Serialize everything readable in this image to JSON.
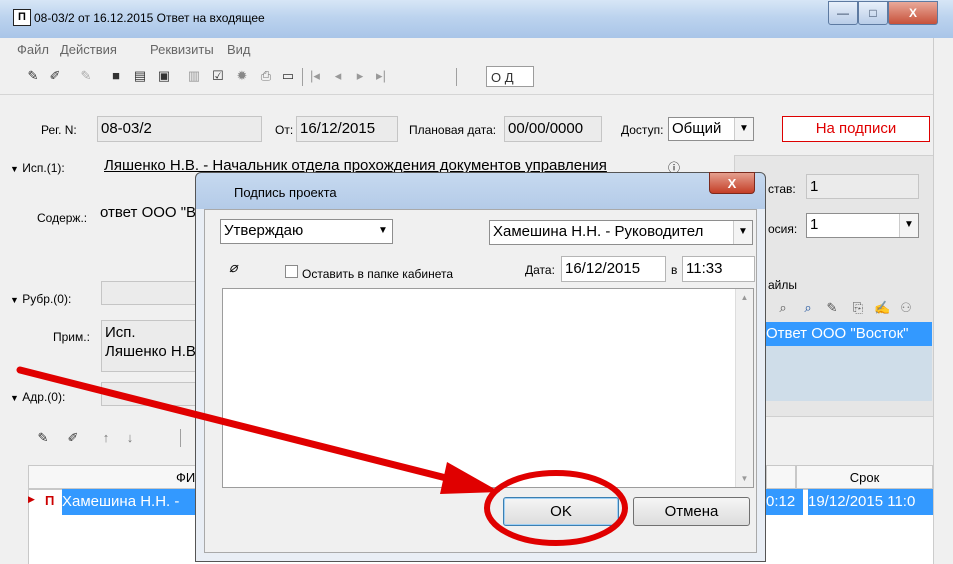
{
  "window": {
    "icon_glyph": "П",
    "title": "08-03/2 от 16.12.2015 Ответ на входящее",
    "buttons": {
      "minimize": "—",
      "maximize": "□",
      "close": "X"
    }
  },
  "menu": [
    "Файл",
    "Действия",
    "Реквизиты",
    "Вид"
  ],
  "toolbar": {
    "box1": "О Д"
  },
  "form": {
    "reg_label": "Рег. N:",
    "reg_value": "08-03/2",
    "from_label": "От:",
    "from_value": "16/12/2015",
    "planned_label": "Плановая дата:",
    "planned_value": "00/00/0000",
    "access_label": "Доступ:",
    "access_value": "Общий",
    "status": "На подписи",
    "executor_label": "Исп.(1):",
    "executor_value": "Ляшенко Н.В. - Начальник отдела прохождения документов управления",
    "content_label": "Содерж.:",
    "content_value": "ответ ООО \"В",
    "rubric_label": "Рубр.(0):",
    "note_label": "Прим.:",
    "note_line1": "Исп.",
    "note_line2": "Ляшенко Н.В",
    "addr_label": "Адр.(0):",
    "sostav_label": "став:",
    "sostav_value": "1",
    "version_label": "осия:",
    "version_value": "1",
    "files_label": "айлы",
    "file_item": "Ответ ООО \"Восток\""
  },
  "grid": {
    "col_fio": "ФИ",
    "col_deadline": "Срок",
    "row_name": "Хамешина Н.Н. -",
    "row_time": "0:12",
    "row_deadline": "19/12/2015 11:0"
  },
  "dialog": {
    "title": "Подпись проекта",
    "close": "X",
    "decision": "Утверждаю",
    "signer": "Хамешина Н.Н. - Руководител",
    "keep_label": "Оставить в папке кабинета",
    "date_label": "Дата:",
    "date_value": "16/12/2015",
    "at_label": "в",
    "time_value": "11:33",
    "ok": "OK",
    "cancel": "Отмена"
  },
  "colors": {
    "status": "#e00000",
    "selection": "#3399ff",
    "annotation": "#e00000"
  }
}
